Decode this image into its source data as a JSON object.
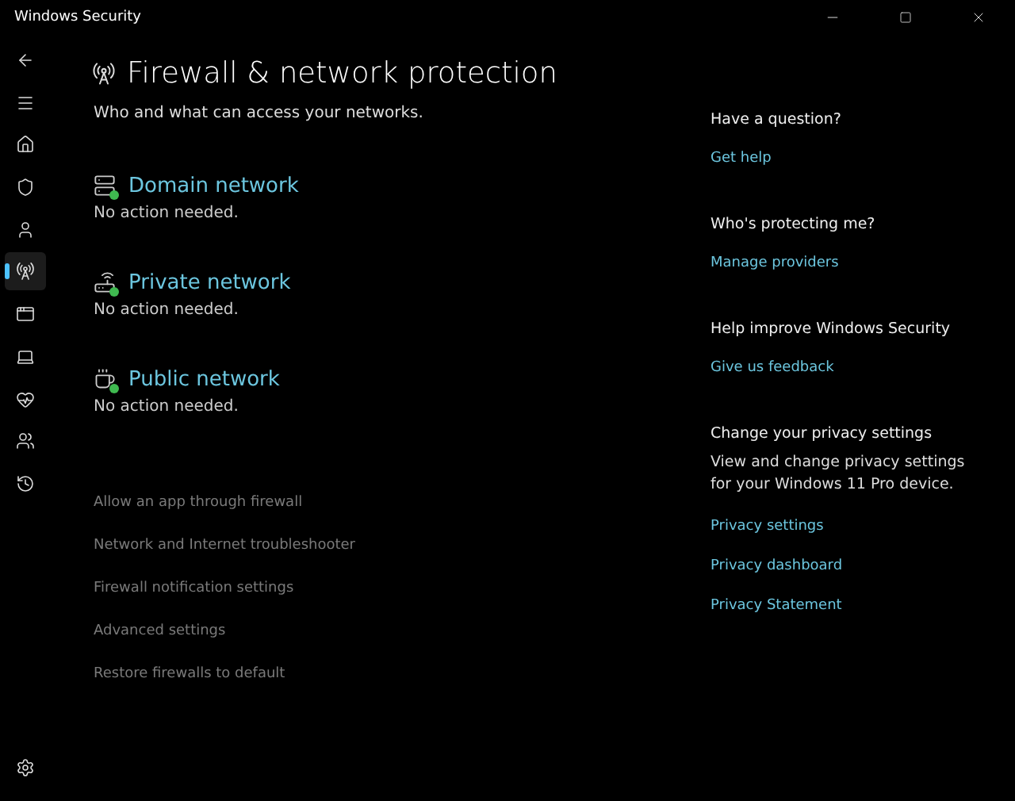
{
  "window": {
    "title": "Windows Security"
  },
  "sidebar": {
    "items": [
      {
        "kind": "back",
        "selected": false
      },
      {
        "kind": "menu",
        "selected": false
      },
      {
        "kind": "home",
        "selected": false
      },
      {
        "kind": "shield",
        "selected": false
      },
      {
        "kind": "person",
        "selected": false
      },
      {
        "kind": "antenna",
        "selected": true
      },
      {
        "kind": "window",
        "selected": false
      },
      {
        "kind": "laptop",
        "selected": false
      },
      {
        "kind": "heart",
        "selected": false
      },
      {
        "kind": "family",
        "selected": false
      },
      {
        "kind": "history",
        "selected": false
      }
    ],
    "bottom": {
      "kind": "settings",
      "selected": false
    }
  },
  "page": {
    "title": "Firewall & network protection",
    "subtitle": "Who and what can access your networks."
  },
  "networks": [
    {
      "kind": "domain",
      "title": "Domain network",
      "status": "No action needed."
    },
    {
      "kind": "private",
      "title": "Private network",
      "status": "No action needed."
    },
    {
      "kind": "public",
      "title": "Public network",
      "status": "No action needed."
    }
  ],
  "links": [
    "Allow an app through firewall",
    "Network and Internet troubleshooter",
    "Firewall notification settings",
    "Advanced settings",
    "Restore firewalls to default"
  ],
  "aside": [
    {
      "heading": "Have a question?",
      "links": [
        "Get help"
      ]
    },
    {
      "heading": "Who's protecting me?",
      "links": [
        "Manage providers"
      ]
    },
    {
      "heading": "Help improve Windows Security",
      "links": [
        "Give us feedback"
      ]
    },
    {
      "heading": "Change your privacy settings",
      "text": "View and change privacy settings for your Windows 11 Pro device.",
      "links": [
        "Privacy settings",
        "Privacy dashboard",
        "Privacy Statement"
      ]
    }
  ]
}
